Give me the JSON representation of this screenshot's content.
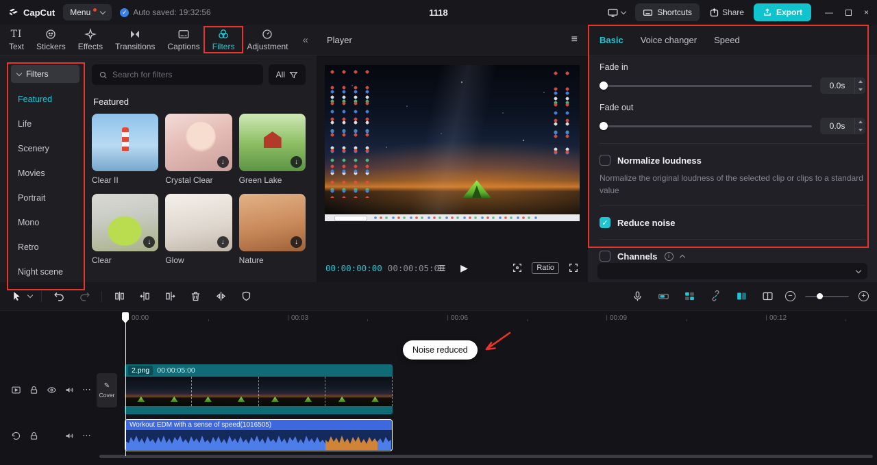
{
  "titlebar": {
    "app_name": "CapCut",
    "menu_label": "Menu",
    "autosave_text": "Auto saved: 19:32:56",
    "doc_title": "1118",
    "shortcuts_label": "Shortcuts",
    "share_label": "Share",
    "export_label": "Export"
  },
  "media_panel": {
    "tabs": [
      {
        "label": "Text"
      },
      {
        "label": "Stickers"
      },
      {
        "label": "Effects"
      },
      {
        "label": "Transitions"
      },
      {
        "label": "Captions"
      },
      {
        "label": "Filters",
        "active": true
      },
      {
        "label": "Adjustment"
      }
    ],
    "sidebar": {
      "root_label": "Filters",
      "items": [
        {
          "label": "Featured",
          "active": true
        },
        {
          "label": "Life"
        },
        {
          "label": "Scenery"
        },
        {
          "label": "Movies"
        },
        {
          "label": "Portrait"
        },
        {
          "label": "Mono"
        },
        {
          "label": "Retro"
        },
        {
          "label": "Night scene"
        }
      ]
    },
    "search_placeholder": "Search for filters",
    "filter_all_label": "All",
    "section_title": "Featured",
    "cards": [
      {
        "name": "Clear II"
      },
      {
        "name": "Crystal Clear"
      },
      {
        "name": "Green Lake"
      },
      {
        "name": "Clear"
      },
      {
        "name": "Glow"
      },
      {
        "name": "Nature"
      }
    ]
  },
  "player": {
    "title": "Player",
    "current_time": "00:00:00:00",
    "duration": "00:00:05:00",
    "ratio_label": "Ratio"
  },
  "properties": {
    "tabs": [
      {
        "label": "Basic",
        "active": true
      },
      {
        "label": "Voice changer"
      },
      {
        "label": "Speed"
      }
    ],
    "fade_in_label": "Fade in",
    "fade_in_value": "0.0s",
    "fade_out_label": "Fade out",
    "fade_out_value": "0.0s",
    "normalize_label": "Normalize loudness",
    "normalize_desc": "Normalize the original loudness of the selected clip or clips to a standard value",
    "reduce_noise_label": "Reduce noise",
    "channels_label": "Channels"
  },
  "timeline": {
    "ruler": [
      "00:00",
      "00:03",
      "00:06",
      "00:09",
      "00:12"
    ],
    "tooltip": "Noise reduced",
    "cover_label": "Cover",
    "video_clip": {
      "name": "2.png",
      "duration": "00:00:05:00"
    },
    "audio_clip": {
      "name": "Workout EDM with a sense of speed(1016505)"
    }
  }
}
